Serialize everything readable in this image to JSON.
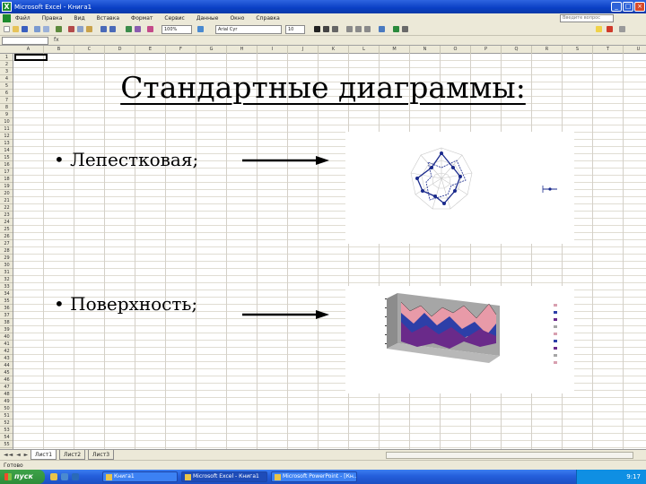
{
  "window": {
    "title": "Microsoft Excel - Книга1",
    "controls": {
      "minimize": "_",
      "maximize": "□",
      "close": "×"
    }
  },
  "menu": {
    "items": [
      "Файл",
      "Правка",
      "Вид",
      "Вставка",
      "Формат",
      "Сервис",
      "Данные",
      "Окно",
      "Справка"
    ],
    "help_placeholder": "Введите вопрос"
  },
  "toolbar": {
    "zoom": "100%",
    "font": "Arial Cyr",
    "size": "10"
  },
  "formula": {
    "name_box": "",
    "fx_label": "fx",
    "value": ""
  },
  "slide": {
    "title": "Стандартные диаграммы:",
    "bullets": [
      {
        "text": "• Лепестковая;"
      },
      {
        "text": "• Поверхность;"
      }
    ]
  },
  "charts": {
    "colors": {
      "radar": "#1a2a8c",
      "surface_wall": "#a6a6a6",
      "pink": "#e89aa8",
      "blue": "#2d3fa8",
      "purple": "#6a2a8a"
    }
  },
  "sheets": {
    "tabs": [
      "Лист1",
      "Лист2",
      "Лист3"
    ],
    "active": "Лист1",
    "nav": "◄◄ ◄ ► ►►"
  },
  "status": {
    "text": "Готово"
  },
  "taskbar": {
    "start_label": "пуск",
    "tasks": [
      "Книга1",
      "Microsoft Excel - Книга1",
      "Microsoft PowerPoint - [Кн..."
    ],
    "clock": "9:17"
  }
}
